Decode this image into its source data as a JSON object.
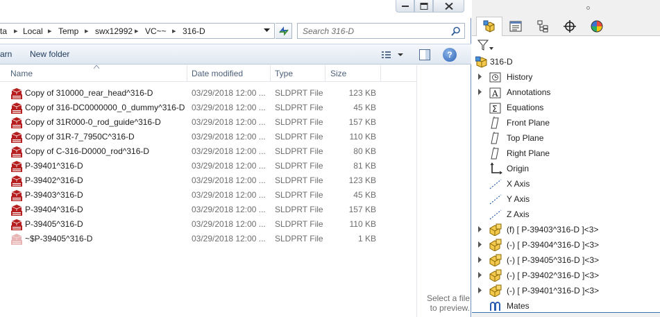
{
  "explorer": {
    "breadcrumbs": [
      "ta",
      "Local",
      "Temp",
      "swx12992",
      "VC~~",
      "316-D"
    ],
    "search_placeholder": "Search 316-D",
    "toolbar": {
      "left_item": "arn",
      "new_folder": "New folder",
      "help": "?"
    },
    "columns": {
      "name": "Name",
      "date": "Date modified",
      "type": "Type",
      "size": "Size"
    },
    "files": [
      {
        "name": "Copy of 310000_rear_head^316-D",
        "date": "03/29/2018 12:00 ...",
        "type": "SLDPRT File",
        "size": "123 KB",
        "icon": "sldprt-2016-icon"
      },
      {
        "name": "Copy of 316-DC0000000_0_dummy^316-D",
        "date": "03/29/2018 12:00 ...",
        "type": "SLDPRT File",
        "size": "45 KB",
        "icon": "sldprt-2016-icon"
      },
      {
        "name": "Copy of 31R000-0_rod_guide^316-D",
        "date": "03/29/2018 12:00 ...",
        "type": "SLDPRT File",
        "size": "157 KB",
        "icon": "sldprt-2016-icon"
      },
      {
        "name": "Copy of 31R-7_7950C^316-D",
        "date": "03/29/2018 12:00 ...",
        "type": "SLDPRT File",
        "size": "110 KB",
        "icon": "sldprt-2016-icon"
      },
      {
        "name": "Copy of C-316-D0000_rod^316-D",
        "date": "03/29/2018 12:00 ...",
        "type": "SLDPRT File",
        "size": "80 KB",
        "icon": "sldprt-2016-icon"
      },
      {
        "name": "P-39401^316-D",
        "date": "03/29/2018 12:00 ...",
        "type": "SLDPRT File",
        "size": "81 KB",
        "icon": "sldprt-2016-icon"
      },
      {
        "name": "P-39402^316-D",
        "date": "03/29/2018 12:00 ...",
        "type": "SLDPRT File",
        "size": "123 KB",
        "icon": "sldprt-2016-icon"
      },
      {
        "name": "P-39403^316-D",
        "date": "03/29/2018 12:00 ...",
        "type": "SLDPRT File",
        "size": "45 KB",
        "icon": "sldprt-2016-icon"
      },
      {
        "name": "P-39404^316-D",
        "date": "03/29/2018 12:00 ...",
        "type": "SLDPRT File",
        "size": "157 KB",
        "icon": "sldprt-2016-icon"
      },
      {
        "name": "P-39405^316-D",
        "date": "03/29/2018 12:00 ...",
        "type": "SLDPRT File",
        "size": "110 KB",
        "icon": "sldprt-2016-icon"
      },
      {
        "name": "~$P-39405^316-D",
        "date": "03/29/2018 12:00 ...",
        "type": "SLDPRT File",
        "size": "1 KB",
        "icon": "sldprt-2016-faded-icon"
      }
    ],
    "preview_message": "Select a file to preview."
  },
  "solidworks": {
    "tabs": [
      "featuremanager-icon",
      "propertymanager-icon",
      "configurationmanager-icon",
      "dimxpert-icon",
      "appearance-icon"
    ],
    "tree": [
      {
        "label": "316-D",
        "icon": "assembly-icon",
        "expander": false
      },
      {
        "label": "History",
        "icon": "history-icon",
        "expander": true
      },
      {
        "label": "Annotations",
        "icon": "annotations-icon",
        "expander": true
      },
      {
        "label": "Equations",
        "icon": "equations-icon",
        "expander": false
      },
      {
        "label": "Front Plane",
        "icon": "plane-icon",
        "expander": false
      },
      {
        "label": "Top Plane",
        "icon": "plane-icon",
        "expander": false
      },
      {
        "label": "Right Plane",
        "icon": "plane-icon",
        "expander": false
      },
      {
        "label": "Origin",
        "icon": "origin-icon",
        "expander": false
      },
      {
        "label": "X Axis",
        "icon": "axis-icon",
        "expander": false
      },
      {
        "label": "Y Axis",
        "icon": "axis-icon",
        "expander": false
      },
      {
        "label": "Z Axis",
        "icon": "axis-icon",
        "expander": false
      },
      {
        "label": "(f) [ P-39403^316-D ]<3>",
        "icon": "part-icon",
        "expander": true
      },
      {
        "label": "(-) [ P-39404^316-D ]<3>",
        "icon": "part-icon",
        "expander": true
      },
      {
        "label": "(-) [ P-39405^316-D ]<3>",
        "icon": "part-icon",
        "expander": true
      },
      {
        "label": "(-) [ P-39402^316-D ]<3>",
        "icon": "part-icon",
        "expander": true
      },
      {
        "label": "(-) [ P-39401^316-D ]<3>",
        "icon": "part-icon",
        "expander": true
      },
      {
        "label": "Mates",
        "icon": "mates-icon",
        "expander": false
      }
    ]
  }
}
